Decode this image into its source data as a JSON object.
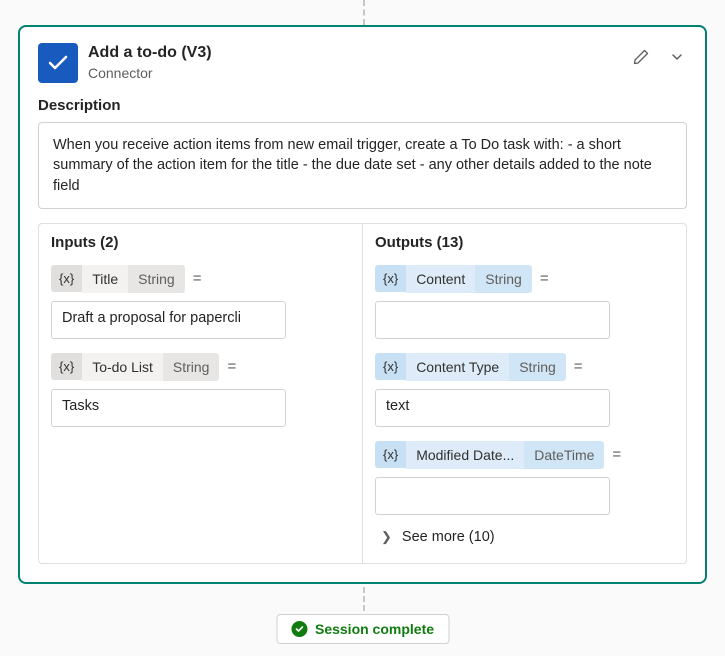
{
  "header": {
    "title": "Add a to-do (V3)",
    "subtitle": "Connector"
  },
  "description": {
    "label": "Description",
    "text": "When you receive action items from new email trigger, create a To Do task with: - a short summary of the action item for the title - the due date set - any other details added to the note field"
  },
  "inputs": {
    "title": "Inputs (2)",
    "items": [
      {
        "fx": "{x}",
        "name": "Title",
        "type": "String",
        "value": "Draft a proposal for papercli"
      },
      {
        "fx": "{x}",
        "name": "To-do List",
        "type": "String",
        "value": "Tasks"
      }
    ]
  },
  "outputs": {
    "title": "Outputs (13)",
    "items": [
      {
        "fx": "{x}",
        "name": "Content",
        "type": "String",
        "value": ""
      },
      {
        "fx": "{x}",
        "name": "Content Type",
        "type": "String",
        "value": "text"
      },
      {
        "fx": "{x}",
        "name": "Modified Date...",
        "type": "DateTime",
        "value": ""
      }
    ],
    "see_more": "See more (10)"
  },
  "session": {
    "label": "Session complete"
  },
  "eq": "="
}
